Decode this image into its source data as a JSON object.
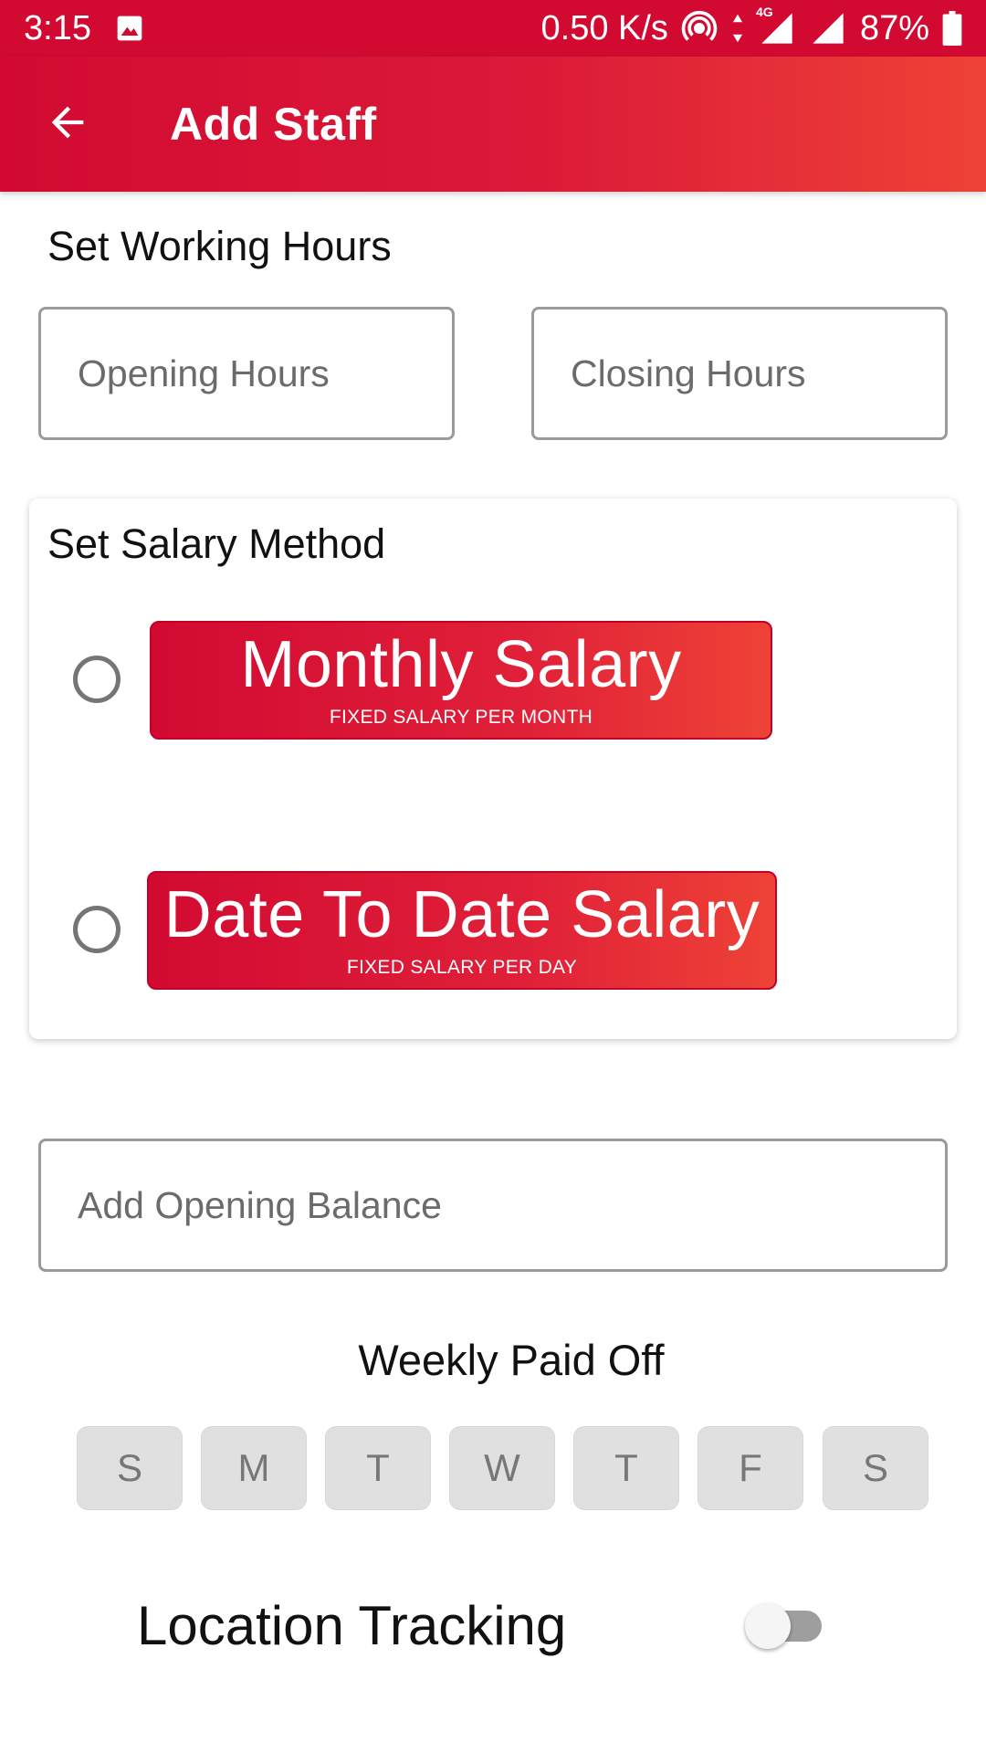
{
  "status_bar": {
    "time": "3:15",
    "network_speed": "0.50 K/s",
    "network_type": "4G",
    "battery": "87%",
    "icons": [
      "image-icon",
      "hotspot-icon",
      "data-arrows-icon",
      "signal-icon",
      "signal-icon",
      "battery-icon"
    ]
  },
  "app_bar": {
    "title": "Add Staff",
    "back_icon": "arrow-left-icon",
    "gradient_colors": [
      "#d20a32",
      "#ee4236"
    ]
  },
  "working_hours": {
    "label": "Set Working Hours",
    "opening_placeholder": "Opening Hours",
    "closing_placeholder": "Closing Hours"
  },
  "salary_method": {
    "label": "Set Salary Method",
    "options": [
      {
        "title": "Monthly Salary",
        "subtitle": "FIXED SALARY PER MONTH",
        "selected": false
      },
      {
        "title": "Date To Date Salary",
        "subtitle": "FIXED SALARY PER DAY",
        "selected": false
      }
    ]
  },
  "opening_balance": {
    "placeholder": "Add Opening Balance"
  },
  "weekly_off": {
    "label": "Weekly Paid Off",
    "days": [
      "S",
      "M",
      "T",
      "W",
      "T",
      "F",
      "S"
    ]
  },
  "location_tracking": {
    "label": "Location Tracking",
    "enabled": false
  },
  "colors": {
    "accent": "#d20a32",
    "accent_end": "#ee4236",
    "day_button_bg": "#e0e0e0"
  }
}
